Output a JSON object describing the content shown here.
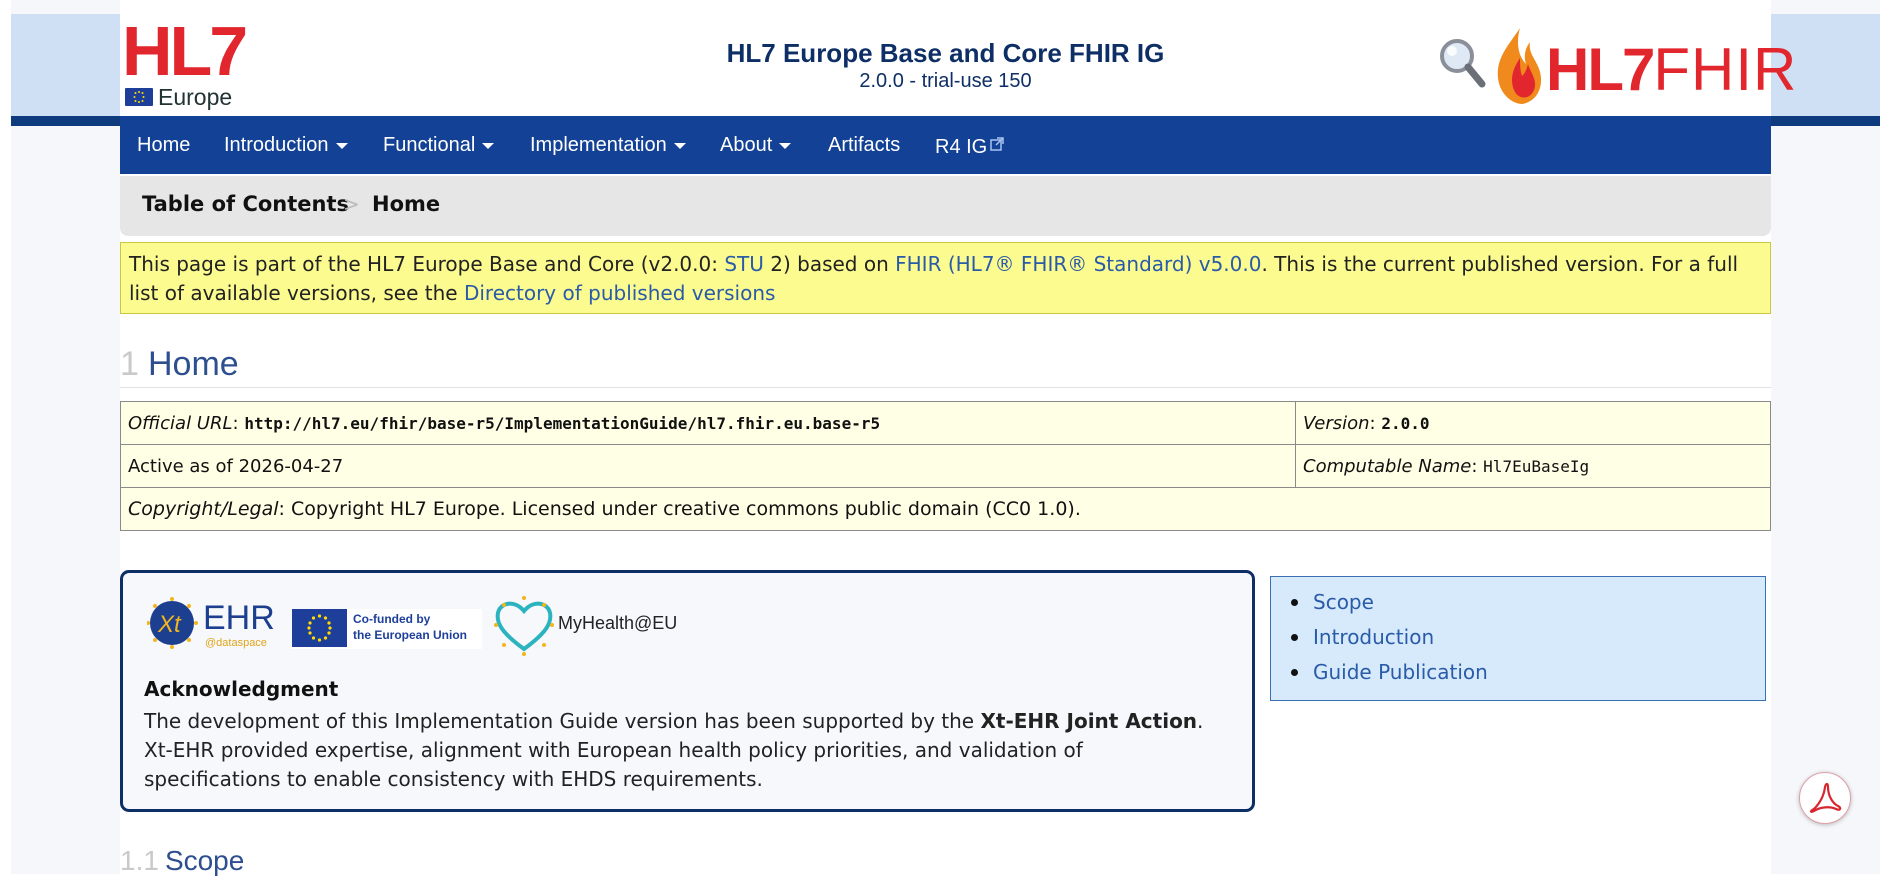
{
  "header": {
    "hl7_logo_text": "HL7",
    "europe_text": "Europe",
    "title": "HL7 Europe Base and Core FHIR IG",
    "subtitle": "2.0.0 - trial-use 150",
    "fhir_logo_bold": "HL7",
    "fhir_logo_text": "FHIR",
    "search_icon": "magnifier-icon"
  },
  "nav": {
    "items": [
      {
        "label": "Home",
        "dropdown": false
      },
      {
        "label": "Introduction",
        "dropdown": true
      },
      {
        "label": "Functional",
        "dropdown": true
      },
      {
        "label": "Implementation",
        "dropdown": true
      },
      {
        "label": "About",
        "dropdown": true
      },
      {
        "label": "Artifacts",
        "dropdown": false
      },
      {
        "label": "R4 IG",
        "dropdown": false,
        "external": true
      }
    ]
  },
  "breadcrumb": {
    "items": [
      "Table of Contents",
      "Home"
    ],
    "separator": ">"
  },
  "notice": {
    "part1": "This page is part of the HL7 Europe Base and Core (v2.0.0: ",
    "stu_link": "STU",
    "part2": " 2) based on ",
    "fhir_link": "FHIR (HL7® FHIR® Standard) v5.0.0",
    "part3": ". This is the current published version. For a full list of available versions, see the ",
    "directory_link": "Directory of published versions"
  },
  "page": {
    "section_number": "1",
    "title": "Home"
  },
  "info_table": {
    "official_url_label": "Official URL",
    "official_url": "http://hl7.eu/fhir/base-r5/ImplementationGuide/hl7.fhir.eu.base-r5",
    "version_label": "Version",
    "version": "2.0.0",
    "active_text": "Active as of 2026-04-27",
    "computable_name_label": "Computable Name",
    "computable_name": "Hl7EuBaseIg",
    "copyright_label": "Copyright/Legal",
    "copyright_text": "Copyright HL7 Europe. Licensed under creative commons public domain (CC0 1.0)."
  },
  "acknowledgment": {
    "xt_logo_text": "EHR",
    "xt_logo_sub": "@dataspace",
    "cofund_line1": "Co-funded by",
    "cofund_line2": "the European Union",
    "myhealth_text": "MyHealth@EU",
    "title": "Acknowledgment",
    "text1": "The development of this Implementation Guide version has been supported by the ",
    "bold": "Xt-EHR Joint Action",
    "text2": ". Xt-EHR provided expertise, alignment with European health policy priorities, and validation of specifications to enable consistency with EHDS requirements."
  },
  "toc": {
    "items": [
      "Scope",
      "Introduction",
      "Guide Publication"
    ]
  },
  "section": {
    "number": "1.1",
    "title": "Scope"
  },
  "pdf_button_icon": "pdf-icon",
  "colors": {
    "nav_bg": "#134196",
    "link": "#2a5ba8",
    "notice_bg": "#fbfb8f",
    "table_bg": "#ffffe6",
    "toc_bg": "#d6eafc",
    "hl7_red": "#e1262d"
  }
}
